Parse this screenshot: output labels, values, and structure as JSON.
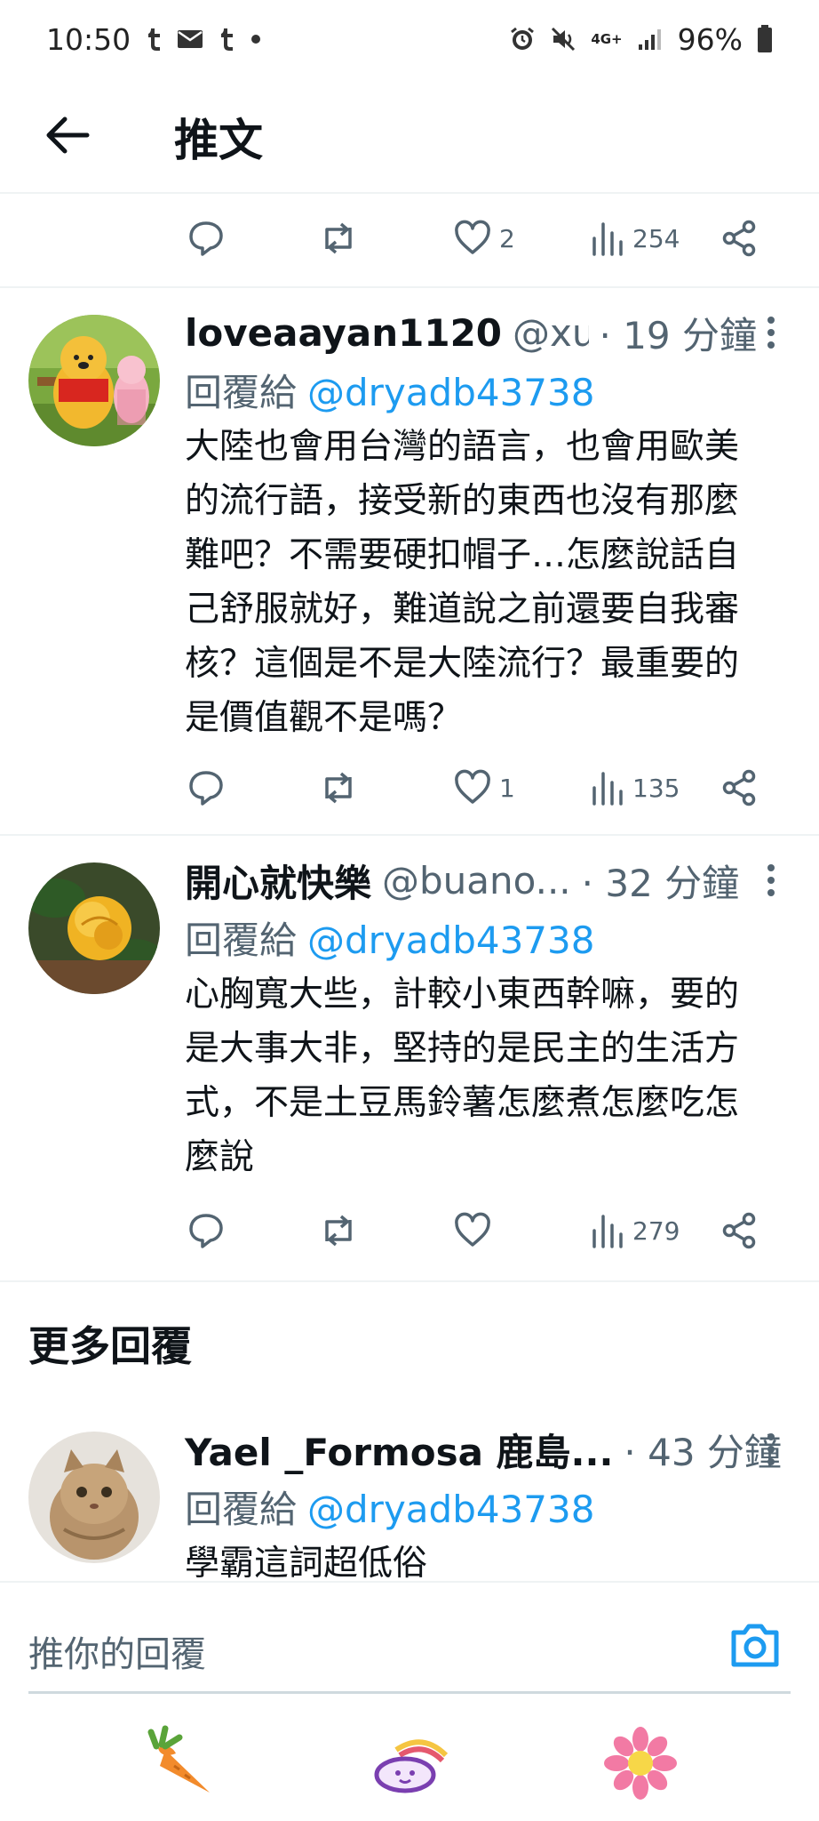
{
  "status_bar": {
    "time": "10:50",
    "notif_icons": [
      "tumblr-icon",
      "mail-icon",
      "tumblr-icon",
      "dot-icon"
    ],
    "battery": "96%",
    "network": "4G+"
  },
  "header": {
    "title": "推文"
  },
  "top_actions": {
    "likes": "2",
    "views": "254"
  },
  "tweets": [
    {
      "name": "loveaayan1120",
      "handle": "@xu...",
      "time": "· 19 分鐘",
      "reply_label": "回覆給",
      "reply_mention": "@dryadb43738",
      "text_lines": [
        "大陸也會用台灣的語言，也會用歐美",
        "的流行語，接受新的東西也沒有那麼",
        "難吧？不需要硬扣帽子…怎麼說話自",
        "己舒服就好，難道說之前還要自我審",
        "核？這個是不是大陸流行？最重要的",
        "是價值觀不是嗎？"
      ],
      "likes": "1",
      "views": "135"
    },
    {
      "name": "開心就快樂",
      "handle": "@buano...",
      "time": "· 32 分鐘",
      "reply_label": "回覆給",
      "reply_mention": "@dryadb43738",
      "text_lines": [
        "心胸寬大些，計較小東西幹嘛，要的",
        "是大事大非，堅持的是民主的生活方",
        "式，不是土豆馬鈴薯怎麼煮怎麼吃怎",
        "麼說"
      ],
      "likes": "",
      "views": "279"
    }
  ],
  "more_replies_title": "更多回覆",
  "more_reply": {
    "name": "Yael _Formosa 鹿島...",
    "time": "· 43 分鐘",
    "reply_label": "回覆給",
    "reply_mention": "@dryadb43738",
    "text": "學霸這詞超低俗"
  },
  "composer": {
    "placeholder": "推你的回覆"
  },
  "colors": {
    "accent": "#1d9bf0",
    "secondary_text": "#536471",
    "divider": "#eff3f4"
  }
}
